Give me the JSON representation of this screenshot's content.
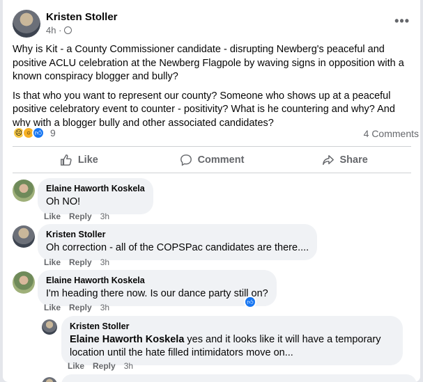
{
  "post": {
    "author": "Kristen Stoller",
    "time": "4h ·",
    "more": "•••",
    "paragraphs": [
      "Why is Kit - a County Commissioner candidate - disrupting Newberg's peaceful and positive ACLU celebration at the Newberg Flagpole by waving signs in opposition with a known conspiracy blogger and bully?",
      "Is that who you want to represent our county? Someone who shows up at a peaceful positive celebratory event to counter - positivity? What is he countering and why? And why with a blogger bully and other associated candidates?"
    ],
    "reaction_count": "9",
    "comments_count": "4 Comments"
  },
  "actions": {
    "like": "Like",
    "comment": "Comment",
    "share": "Share"
  },
  "comments": [
    {
      "name": "Elaine Haworth Koskela",
      "text": "Oh NO!",
      "like": "Like",
      "reply": "Reply",
      "time": "3h"
    },
    {
      "name": "Kristen Stoller",
      "text": "Oh correction - all of the COPSPac candidates are there....",
      "like": "Like",
      "reply": "Reply",
      "time": "3h"
    },
    {
      "name": "Elaine Haworth Koskela",
      "text": "I'm heading there now. Is our dance party still on?",
      "like": "Like",
      "reply": "Reply",
      "time": "3h"
    },
    {
      "name": "Kristen Stoller",
      "tag": "Elaine Haworth Koskela",
      "text": " yes and it looks like it will have a temporary location until the hate filled intimidators move on...",
      "like": "Like",
      "reply": "Reply",
      "time": "3h"
    }
  ],
  "icons": [
    "globe-icon",
    "like-thumb-icon",
    "comment-icon",
    "share-icon",
    "sad-reaction-icon",
    "wow-reaction-icon",
    "like-reaction-icon"
  ],
  "colors": {
    "accent": "#1877f2",
    "secondary_text": "#65676b",
    "bubble": "#f0f2f5"
  }
}
